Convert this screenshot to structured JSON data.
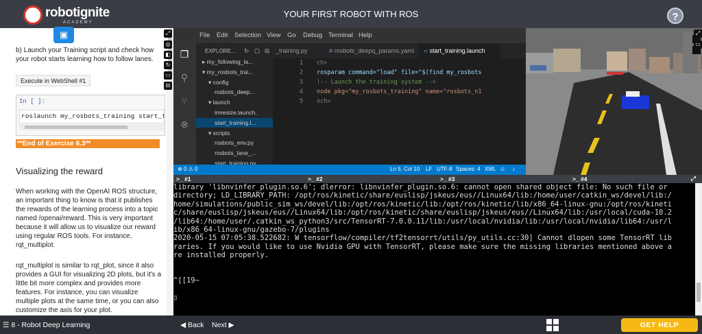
{
  "header": {
    "title": "YOUR FIRST ROBOT WITH ROS",
    "logo_text": "robotignite",
    "logo_sub": "ACADEMY",
    "help_label": "?"
  },
  "notebook": {
    "instruction": "b) Launch your Training script and check how your robot starts learning how to follow lanes.",
    "exec_button": "Execute in WebShell #1",
    "cell_prompt": "In [ ]:",
    "cell_code": "roslaunch my_rosbots_training start_training.launch",
    "end_banner": "**End of Exercise 6.3**",
    "heading": "Visualizing the reward",
    "para1": "When working with the OpenAI ROS structure, an important thing to know is that it publishes the rewards of the learning process into a topic named /openai/reward. This is very important because it will allow us to visualize our reward using regular ROS tools. For instance, rqt_multiplot.",
    "para2": "rqt_multiplot is similar to rqt_plot, since it also provides a GUI for visualizing 2D plots, but it's a little bit more complex and provides more features. For instance, you can visualize multiple plots at the same time, or you can also customize the axis for your plot."
  },
  "ide": {
    "menu": [
      "File",
      "Edit",
      "Selection",
      "View",
      "Go",
      "Debug",
      "Terminal",
      "Help"
    ],
    "explorer_title": "EXPLORE...",
    "tree": [
      {
        "label": "my_following_la...",
        "indent": 1,
        "arrow": "▸"
      },
      {
        "label": "my_rosbots_trai...",
        "indent": 1,
        "arrow": "▾"
      },
      {
        "label": "config",
        "indent": 2,
        "arrow": "▾"
      },
      {
        "label": "rosbots_deep...",
        "indent": 3,
        "arrow": ""
      },
      {
        "label": "launch",
        "indent": 2,
        "arrow": "▾"
      },
      {
        "label": "imresize.launch,",
        "indent": 3,
        "arrow": ""
      },
      {
        "label": "start_training.l...",
        "indent": 3,
        "arrow": "",
        "selected": true
      },
      {
        "label": "scripts",
        "indent": 2,
        "arrow": "▾"
      },
      {
        "label": "rosbots_env.py",
        "indent": 3,
        "arrow": ""
      },
      {
        "label": "rosbots_lane_...",
        "indent": 3,
        "arrow": ""
      },
      {
        "label": "start_training.py",
        "indent": 3,
        "arrow": ""
      }
    ],
    "tabs": [
      {
        "label": "_training.py",
        "active": false
      },
      {
        "label": "rosbots_deepq_params.yaml",
        "active": false
      },
      {
        "label": "start_training.launch",
        "active": true
      }
    ],
    "code": [
      {
        "n": "1",
        "text": "ch>"
      },
      {
        "n": "2",
        "text": "rosparam command=\"load\" file=\"$(find my_rosbots"
      },
      {
        "n": "3",
        "text": "!-- Launch the training system -->"
      },
      {
        "n": "4",
        "text": "node pkg=\"my_rosbots_training\" name=\"rosbots_n1"
      },
      {
        "n": "5",
        "text": "nch>"
      }
    ],
    "status": {
      "problems": "⊗ 0 ⚠ 0",
      "position": "Ln 5, Col 10",
      "eol": "LF",
      "encoding": "UTF-8",
      "spaces": "Spaces: 4",
      "lang": "XML"
    }
  },
  "terminal": {
    "tabs": [
      ">_ #1",
      ">_ #2",
      ">_ #3",
      ">_ #4"
    ],
    "lines": [
      "library 'libnvinfer_plugin.so.6'; dlerror: libnvinfer_plugin.so.6: cannot open shared object file: No such file or",
      "directory; LD_LIBRARY_PATH: /opt/ros/kinetic/share/euslisp/jskeus/eus//Linux64/lib:/home/user/catkin_ws/devel/lib:/",
      "home/simulations/public_sim_ws/devel/lib:/opt/ros/kinetic/lib:/opt/ros/kinetic/lib/x86_64-linux-gnu:/opt/ros/kineti",
      "c/share/euslisp/jskeus/eus//Linux64/lib:/opt/ros/kinetic/share/euslisp/jskeus/eus//Linux64/lib:/usr/local/cuda-10.2",
      "/lib64:/home/user/.catkin_ws_python3/src/TensorRT-7.0.0.11/lib:/usr/local/nvidia/lib:/usr/local/nvidia/lib64:/usr/l",
      "ib/x86_64-linux-gnu/gazebo-7/plugins",
      "2020-05-15 07:05:38.522682: W tensorflow/compiler/tf2tensorrt/utils/py_utils.cc:30] Cannot dlopen some TensorRT lib",
      "raries. If you would like to use Nvidia GPU with TensorRT, please make sure the missing libraries mentioned above a",
      "re installed properly.",
      "",
      "",
      "^[[19~",
      "",
      "▯"
    ]
  },
  "footer": {
    "chapter": "8 - Robot Deep Learning",
    "back": "◀ Back",
    "next": "Next ▶",
    "get_help": "GET HELP"
  }
}
